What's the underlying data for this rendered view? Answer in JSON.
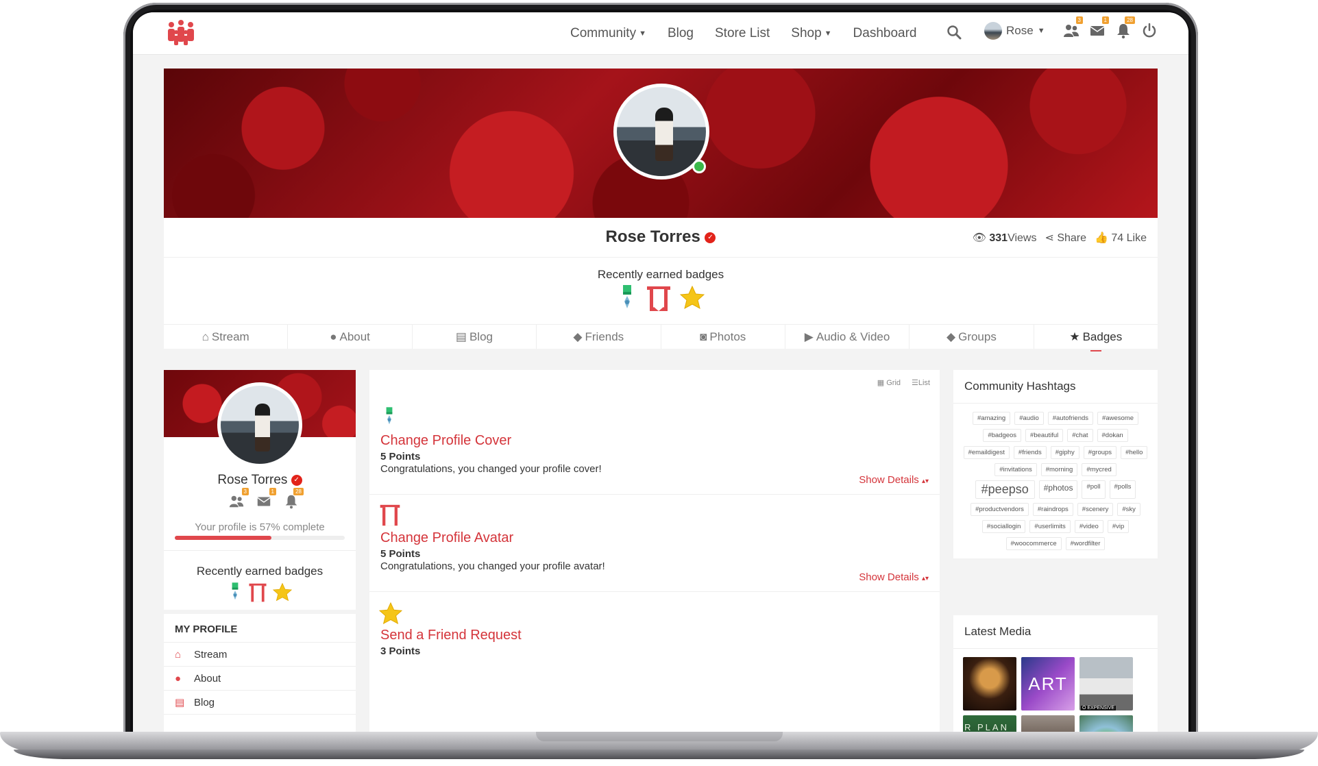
{
  "nav": {
    "links": [
      {
        "label": "Community",
        "has_caret": true
      },
      {
        "label": "Blog",
        "has_caret": false
      },
      {
        "label": "Store List",
        "has_caret": false
      },
      {
        "label": "Shop",
        "has_caret": true
      },
      {
        "label": "Dashboard",
        "has_caret": false
      }
    ],
    "user_name": "Rose",
    "badge_counts": {
      "friends": "3",
      "messages": "1",
      "notifications": "28"
    }
  },
  "profile": {
    "name": "Rose Torres",
    "views_count": "331",
    "views_label": "Views",
    "share_label": "Share",
    "like_label": "74 Like",
    "recent_badges_title": "Recently earned badges",
    "tabs": [
      {
        "label": "Stream",
        "icon": "home-icon"
      },
      {
        "label": "About",
        "icon": "user-icon"
      },
      {
        "label": "Blog",
        "icon": "blog-icon"
      },
      {
        "label": "Friends",
        "icon": "friends-icon"
      },
      {
        "label": "Photos",
        "icon": "camera-icon"
      },
      {
        "label": "Audio & Video",
        "icon": "video-icon"
      },
      {
        "label": "Groups",
        "icon": "groups-icon"
      },
      {
        "label": "Badges",
        "icon": "star-icon"
      }
    ],
    "active_tab": "Badges"
  },
  "sidebar": {
    "name": "Rose Torres",
    "profile_complete_text": "Your profile is 57% complete",
    "profile_complete_pct": 57,
    "recent_badges_title": "Recently earned badges",
    "my_profile_title": "MY PROFILE",
    "menu": [
      "Stream",
      "About",
      "Blog"
    ],
    "badge_counts": {
      "friends": "3",
      "messages": "1",
      "notifications": "28"
    }
  },
  "main": {
    "view_grid": "Grid",
    "view_list": "List",
    "badges": [
      {
        "title": "Change Profile Cover",
        "points": "5 Points",
        "desc": "Congratulations, you changed your profile cover!",
        "details": "Show Details",
        "icon": "medal-icon"
      },
      {
        "title": "Change Profile Avatar",
        "points": "5 Points",
        "desc": "Congratulations, you changed your profile avatar!",
        "details": "Show Details",
        "icon": "banner-icon"
      },
      {
        "title": "Send a Friend Request",
        "points": "3 Points",
        "desc": "",
        "details": "",
        "icon": "star-icon"
      }
    ]
  },
  "hashtags": {
    "title": "Community Hashtags",
    "tags": [
      "#amazing",
      "#audio",
      "#autofriends",
      "#awesome",
      "#badgeos",
      "#beautiful",
      "#chat",
      "#dokan",
      "#emaildigest",
      "#friends",
      "#giphy",
      "#groups",
      "#hello",
      "#invitations",
      "#morning",
      "#mycred",
      "#peepso",
      "#photos",
      "#poll",
      "#polls",
      "#productvendors",
      "#raindrops",
      "#scenery",
      "#sky",
      "#sociallogin",
      "#userlimits",
      "#video",
      "#vip",
      "#woocommerce",
      "#wordfilter"
    ],
    "large_tag": "#peepso",
    "medium_tag": "#photos"
  },
  "latest_media": {
    "title": "Latest Media",
    "thumb_texts": [
      "",
      "ART",
      "O EXPENSIVE",
      "R PLAN",
      "",
      ""
    ]
  },
  "colors": {
    "accent": "#e0474c",
    "link_red": "#d4343a",
    "online": "#3bb84a"
  }
}
